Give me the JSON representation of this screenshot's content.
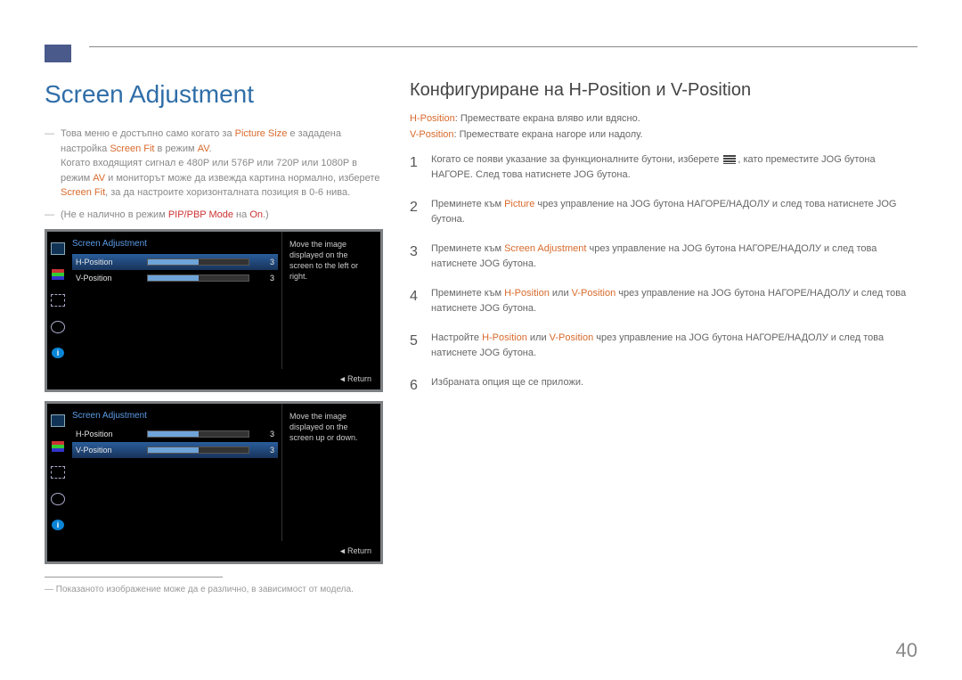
{
  "page_number": "40",
  "heading_left": "Screen Adjustment",
  "heading_right": "Конфигуриране на H-Position и V-Position",
  "note1": {
    "p1a": "Това меню е достъпно само когато за ",
    "p1b": "Picture Size",
    "p1c": " е зададена настройка ",
    "p1d": "Screen Fit",
    "p1e": " в режим ",
    "p1f": "AV",
    "p1g": ".",
    "p2a": "Когато входящият сигнал е 480P или 576P или 720P или 1080P в режим ",
    "p2b": "AV",
    "p2c": " и мониторът може да извежда картина нормално, изберете ",
    "p2d": "Screen Fit",
    "p2e": ", за да настроите хоризонталната позиция в 0-6 нива."
  },
  "note2": {
    "a": "(Не е налично в режим ",
    "b": "PIP/PBP Mode",
    "c": " на ",
    "d": "On",
    "e": ".)"
  },
  "osd": {
    "title": "Screen Adjustment",
    "rows": {
      "h": {
        "label": "H-Position",
        "value": "3"
      },
      "v": {
        "label": "V-Position",
        "value": "3"
      }
    },
    "side1": "Move the image displayed on the screen to the left or right.",
    "side2": "Move the image displayed on the screen up or down.",
    "return": "Return"
  },
  "desc_h": {
    "a": "H-Position",
    "b": ": Премествате екрана вляво или вдясно."
  },
  "desc_v": {
    "a": "V-Position",
    "b": ": Премествате екрана нагоре или надолу."
  },
  "steps": {
    "s1a": "Когато се появи указание за функционалните бутони, изберете ",
    "s1b": ", като преместите JOG бутона НАГОРЕ. След това натиснете JOG бутона.",
    "s2a": "Преминете към ",
    "s2b": "Picture",
    "s2c": " чрез управление на JOG бутона НАГОРЕ/НАДОЛУ и след това натиснете JOG бутона.",
    "s3a": "Преминете към ",
    "s3b": "Screen Adjustment",
    "s3c": " чрез управление на JOG бутона НАГОРЕ/НАДОЛУ и след това натиснете JOG бутона.",
    "s4a": "Преминете към ",
    "s4b": "H-Position",
    "s4c": " или ",
    "s4d": "V-Position",
    "s4e": " чрез управление на JOG бутона НАГОРЕ/НАДОЛУ и след това натиснете JOG бутона.",
    "s5a": "Настройте ",
    "s5b": "H-Position",
    "s5c": " или ",
    "s5d": "V-Position",
    "s5e": " чрез управление на JOG бутона НАГОРЕ/НАДОЛУ и след това натиснете JOG бутона.",
    "s6": "Избраната опция ще се приложи."
  },
  "footnote": "Показаното изображение може да е различно, в зависимост от модела."
}
